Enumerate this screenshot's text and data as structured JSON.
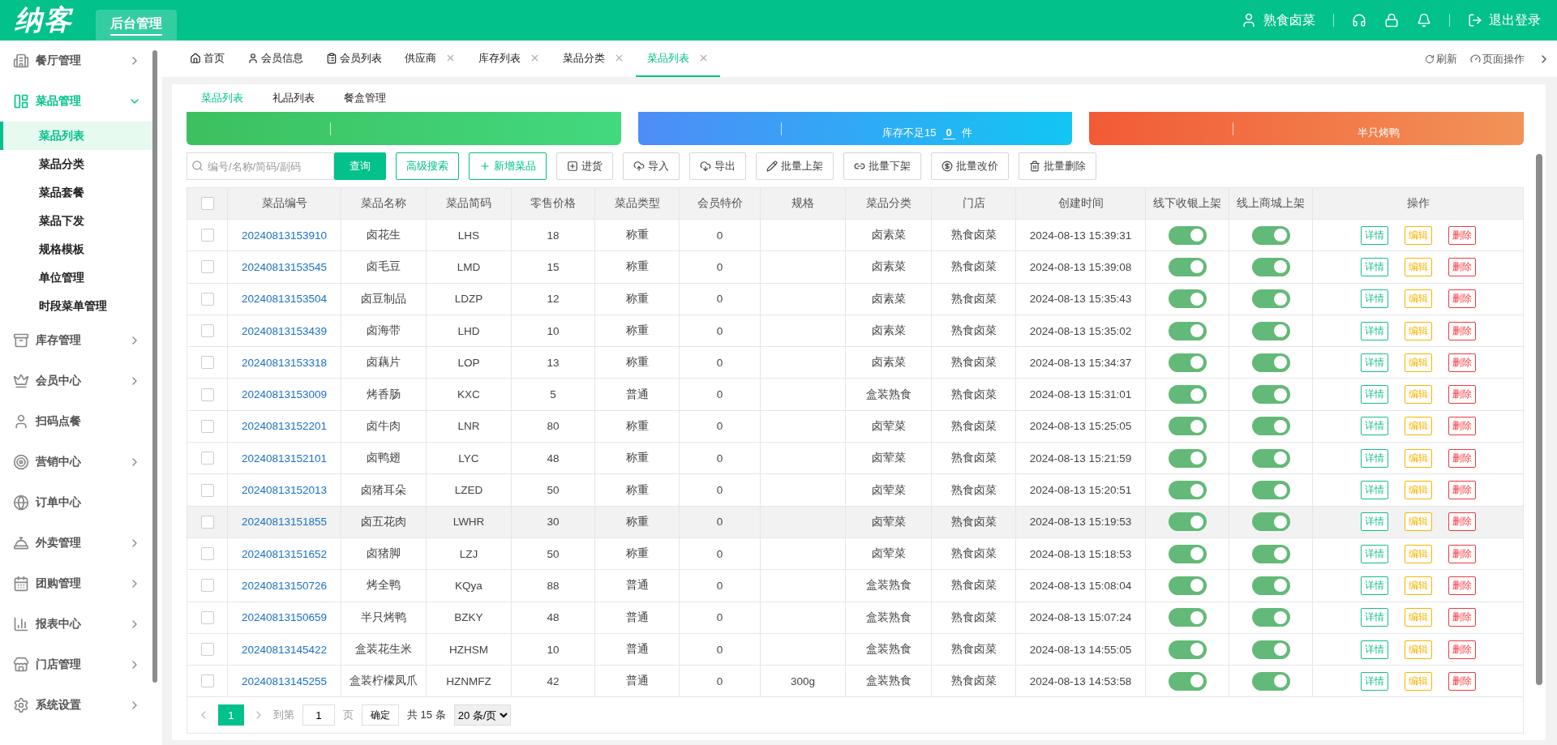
{
  "header": {
    "logo": "纳客",
    "module_tab": {
      "label": "后台管理",
      "selected": true
    },
    "user": "熟食卤菜",
    "logout": "退出登录"
  },
  "sidebar": {
    "items": [
      {
        "label": "餐厅管理",
        "expanded": false,
        "has_children": true
      },
      {
        "label": "菜品管理",
        "expanded": true,
        "has_children": true,
        "children": [
          {
            "label": "菜品列表",
            "selected": true
          },
          {
            "label": "菜品分类",
            "selected": false
          },
          {
            "label": "菜品套餐",
            "selected": false
          },
          {
            "label": "菜品下发",
            "selected": false
          },
          {
            "label": "规格模板",
            "selected": false
          },
          {
            "label": "单位管理",
            "selected": false
          },
          {
            "label": "时段菜单管理",
            "selected": false
          }
        ]
      },
      {
        "label": "库存管理",
        "expanded": false,
        "has_children": true
      },
      {
        "label": "会员中心",
        "expanded": false,
        "has_children": true
      },
      {
        "label": "扫码点餐",
        "expanded": false,
        "has_children": false
      },
      {
        "label": "营销中心",
        "expanded": false,
        "has_children": true
      },
      {
        "label": "订单中心",
        "expanded": false,
        "has_children": false
      },
      {
        "label": "外卖管理",
        "expanded": false,
        "has_children": true
      },
      {
        "label": "团购管理",
        "expanded": false,
        "has_children": true
      },
      {
        "label": "报表中心",
        "expanded": false,
        "has_children": true
      },
      {
        "label": "门店管理",
        "expanded": false,
        "has_children": true
      },
      {
        "label": "系统设置",
        "expanded": false,
        "has_children": true
      }
    ]
  },
  "page_tabs": [
    {
      "label": "首页",
      "closable": false,
      "selected": false
    },
    {
      "label": "会员信息",
      "closable": false,
      "selected": false
    },
    {
      "label": "会员列表",
      "closable": false,
      "selected": false
    },
    {
      "label": "供应商",
      "closable": true,
      "selected": false
    },
    {
      "label": "库存列表",
      "closable": true,
      "selected": false
    },
    {
      "label": "菜品分类",
      "closable": true,
      "selected": false
    },
    {
      "label": "菜品列表",
      "closable": true,
      "selected": true
    }
  ],
  "tab_actions": {
    "refresh": "刷新",
    "page_ops": "页面操作"
  },
  "sub_tabs": [
    {
      "label": "菜品列表",
      "selected": true
    },
    {
      "label": "礼品列表",
      "selected": false
    },
    {
      "label": "餐盒管理",
      "selected": false
    }
  ],
  "summary_cards": [
    {
      "color": "#3cc060"
    },
    {
      "color": "#4f8cf7",
      "texts": [
        "库存不足15",
        "0",
        "件"
      ]
    },
    {
      "color": "#f25a36",
      "texts": [
        "半只烤鸭"
      ]
    }
  ],
  "toolbar": {
    "search_placeholder": "编号/名称/简码/副码",
    "buttons": [
      {
        "label": "查询",
        "kind": "primary"
      },
      {
        "label": "高级搜索",
        "kind": "outline"
      },
      {
        "label": "新增菜品",
        "kind": "add"
      },
      {
        "label": "进货",
        "kind": "stock"
      },
      {
        "label": "导入",
        "kind": "upload"
      },
      {
        "label": "导出",
        "kind": "download"
      },
      {
        "label": "批量上架",
        "kind": "pencil"
      },
      {
        "label": "批量下架",
        "kind": "link"
      },
      {
        "label": "批量改价",
        "kind": "yen"
      },
      {
        "label": "批量删除",
        "kind": "trash"
      }
    ]
  },
  "table": {
    "columns": [
      "菜品编号",
      "菜品名称",
      "菜品简码",
      "零售价格",
      "菜品类型",
      "会员特价",
      "规格",
      "菜品分类",
      "门店",
      "创建时间",
      "线下收银上架",
      "线上商城上架",
      "操作"
    ],
    "select_all_checked": false,
    "rows": [
      {
        "code": "20240813153910",
        "name": "卤花生",
        "short": "LHS",
        "price": "18",
        "type": "称重",
        "member_price": "0",
        "spec": "",
        "category": "卤素菜",
        "store": "熟食卤菜",
        "created": "2024-08-13 15:39:31",
        "offline_on": true,
        "online_on": true,
        "checked": false,
        "highlighted": false,
        "actions": [
          "详情",
          "编辑",
          "删除"
        ]
      },
      {
        "code": "20240813153545",
        "name": "卤毛豆",
        "short": "LMD",
        "price": "15",
        "type": "称重",
        "member_price": "0",
        "spec": "",
        "category": "卤素菜",
        "store": "熟食卤菜",
        "created": "2024-08-13 15:39:08",
        "offline_on": true,
        "online_on": true,
        "checked": false,
        "highlighted": false,
        "actions": [
          "详情",
          "编辑",
          "删除"
        ]
      },
      {
        "code": "20240813153504",
        "name": "卤豆制品",
        "short": "LDZP",
        "price": "12",
        "type": "称重",
        "member_price": "0",
        "spec": "",
        "category": "卤素菜",
        "store": "熟食卤菜",
        "created": "2024-08-13 15:35:43",
        "offline_on": true,
        "online_on": true,
        "checked": false,
        "highlighted": false,
        "actions": [
          "详情",
          "编辑",
          "删除"
        ]
      },
      {
        "code": "20240813153439",
        "name": "卤海带",
        "short": "LHD",
        "price": "10",
        "type": "称重",
        "member_price": "0",
        "spec": "",
        "category": "卤素菜",
        "store": "熟食卤菜",
        "created": "2024-08-13 15:35:02",
        "offline_on": true,
        "online_on": true,
        "checked": false,
        "highlighted": false,
        "actions": [
          "详情",
          "编辑",
          "删除"
        ]
      },
      {
        "code": "20240813153318",
        "name": "卤藕片",
        "short": "LOP",
        "price": "13",
        "type": "称重",
        "member_price": "0",
        "spec": "",
        "category": "卤素菜",
        "store": "熟食卤菜",
        "created": "2024-08-13 15:34:37",
        "offline_on": true,
        "online_on": true,
        "checked": false,
        "highlighted": false,
        "actions": [
          "详情",
          "编辑",
          "删除"
        ]
      },
      {
        "code": "20240813153009",
        "name": "烤香肠",
        "short": "KXC",
        "price": "5",
        "type": "普通",
        "member_price": "0",
        "spec": "",
        "category": "盒装熟食",
        "store": "熟食卤菜",
        "created": "2024-08-13 15:31:01",
        "offline_on": true,
        "online_on": true,
        "checked": false,
        "highlighted": false,
        "actions": [
          "详情",
          "编辑",
          "删除"
        ]
      },
      {
        "code": "20240813152201",
        "name": "卤牛肉",
        "short": "LNR",
        "price": "80",
        "type": "称重",
        "member_price": "0",
        "spec": "",
        "category": "卤荤菜",
        "store": "熟食卤菜",
        "created": "2024-08-13 15:25:05",
        "offline_on": true,
        "online_on": true,
        "checked": false,
        "highlighted": false,
        "actions": [
          "详情",
          "编辑",
          "删除"
        ]
      },
      {
        "code": "20240813152101",
        "name": "卤鸭翅",
        "short": "LYC",
        "price": "48",
        "type": "称重",
        "member_price": "0",
        "spec": "",
        "category": "卤荤菜",
        "store": "熟食卤菜",
        "created": "2024-08-13 15:21:59",
        "offline_on": true,
        "online_on": true,
        "checked": false,
        "highlighted": false,
        "actions": [
          "详情",
          "编辑",
          "删除"
        ]
      },
      {
        "code": "20240813152013",
        "name": "卤猪耳朵",
        "short": "LZED",
        "price": "50",
        "type": "称重",
        "member_price": "0",
        "spec": "",
        "category": "卤荤菜",
        "store": "熟食卤菜",
        "created": "2024-08-13 15:20:51",
        "offline_on": true,
        "online_on": true,
        "checked": false,
        "highlighted": false,
        "actions": [
          "详情",
          "编辑",
          "删除"
        ]
      },
      {
        "code": "20240813151855",
        "name": "卤五花肉",
        "short": "LWHR",
        "price": "30",
        "type": "称重",
        "member_price": "0",
        "spec": "",
        "category": "卤荤菜",
        "store": "熟食卤菜",
        "created": "2024-08-13 15:19:53",
        "offline_on": true,
        "online_on": true,
        "checked": false,
        "highlighted": true,
        "actions": [
          "详情",
          "编辑",
          "删除"
        ]
      },
      {
        "code": "20240813151652",
        "name": "卤猪脚",
        "short": "LZJ",
        "price": "50",
        "type": "称重",
        "member_price": "0",
        "spec": "",
        "category": "卤荤菜",
        "store": "熟食卤菜",
        "created": "2024-08-13 15:18:53",
        "offline_on": true,
        "online_on": true,
        "checked": false,
        "highlighted": false,
        "actions": [
          "详情",
          "编辑",
          "删除"
        ]
      },
      {
        "code": "20240813150726",
        "name": "烤全鸭",
        "short": "KQya",
        "price": "88",
        "type": "普通",
        "member_price": "0",
        "spec": "",
        "category": "盒装熟食",
        "store": "熟食卤菜",
        "created": "2024-08-13 15:08:04",
        "offline_on": true,
        "online_on": true,
        "checked": false,
        "highlighted": false,
        "actions": [
          "详情",
          "编辑",
          "删除"
        ]
      },
      {
        "code": "20240813150659",
        "name": "半只烤鸭",
        "short": "BZKY",
        "price": "48",
        "type": "普通",
        "member_price": "0",
        "spec": "",
        "category": "盒装熟食",
        "store": "熟食卤菜",
        "created": "2024-08-13 15:07:24",
        "offline_on": true,
        "online_on": true,
        "checked": false,
        "highlighted": false,
        "actions": [
          "详情",
          "编辑",
          "删除"
        ]
      },
      {
        "code": "20240813145422",
        "name": "盒装花生米",
        "short": "HZHSM",
        "price": "10",
        "type": "普通",
        "member_price": "0",
        "spec": "",
        "category": "盒装熟食",
        "store": "熟食卤菜",
        "created": "2024-08-13 14:55:05",
        "offline_on": true,
        "online_on": true,
        "checked": false,
        "highlighted": false,
        "actions": [
          "详情",
          "编辑",
          "删除"
        ]
      },
      {
        "code": "20240813145255",
        "name": "盒装柠檬凤爪",
        "short": "HZNMFZ",
        "price": "42",
        "type": "普通",
        "member_price": "0",
        "spec": "300g",
        "category": "盒装熟食",
        "store": "熟食卤菜",
        "created": "2024-08-13 14:53:58",
        "offline_on": true,
        "online_on": true,
        "checked": false,
        "highlighted": false,
        "actions": [
          "详情",
          "编辑",
          "删除"
        ]
      }
    ]
  },
  "pagination": {
    "pages": [
      {
        "label": "1",
        "selected": true
      }
    ],
    "goto_label": "到第",
    "goto_value": "1",
    "page_unit": "页",
    "confirm": "确定",
    "total": "共 15 条",
    "page_size": "20 条/页"
  }
}
